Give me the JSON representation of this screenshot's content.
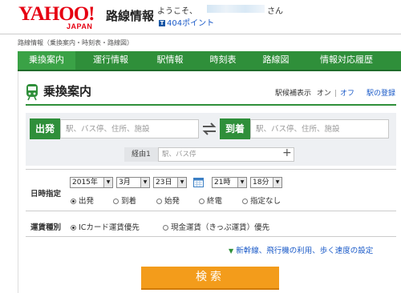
{
  "header": {
    "logo": "YAHOO!",
    "logo_sub": "JAPAN",
    "service": "路線情報",
    "welcome": "ようこそ、",
    "honorific": "さん",
    "points": "404ポイント"
  },
  "breadcrumb": "路線情報（乗換案内・時刻表・路線図）",
  "nav": {
    "items": [
      "乗換案内",
      "運行情報",
      "駅情報",
      "時刻表",
      "路線図",
      "情報対応履歴"
    ],
    "active_index": 0
  },
  "section": {
    "title": "乗換案内",
    "station_label": "駅候補表示",
    "on": "オン",
    "off": "オフ",
    "station_register": "駅の登録"
  },
  "route": {
    "from_label": "出発",
    "from_placeholder": "駅、バス停、住所、施設",
    "to_label": "到着",
    "to_placeholder": "駅、バス停、住所、施設",
    "via_label": "経由1",
    "via_placeholder": "駅、バス停",
    "via_add": "+"
  },
  "datetime": {
    "label": "日時指定",
    "year": "2015年",
    "month": "3月",
    "day": "23日",
    "hour": "21時",
    "minute": "18分",
    "options": [
      "出発",
      "到着",
      "始発",
      "終電",
      "指定なし"
    ],
    "selected": 0
  },
  "fare": {
    "label": "運賃種別",
    "options": [
      "ICカード運賃優先",
      "現金運賃（きっぷ運賃）優先"
    ],
    "selected": 0
  },
  "settings_link": "新幹線、飛行機の利用、歩く速度の設定",
  "search_button": "検索",
  "colors": {
    "brand_red": "#e60012",
    "nav_green": "#2f8f3a",
    "search_orange": "#f39c1b",
    "link_blue": "#1a5ac8"
  }
}
